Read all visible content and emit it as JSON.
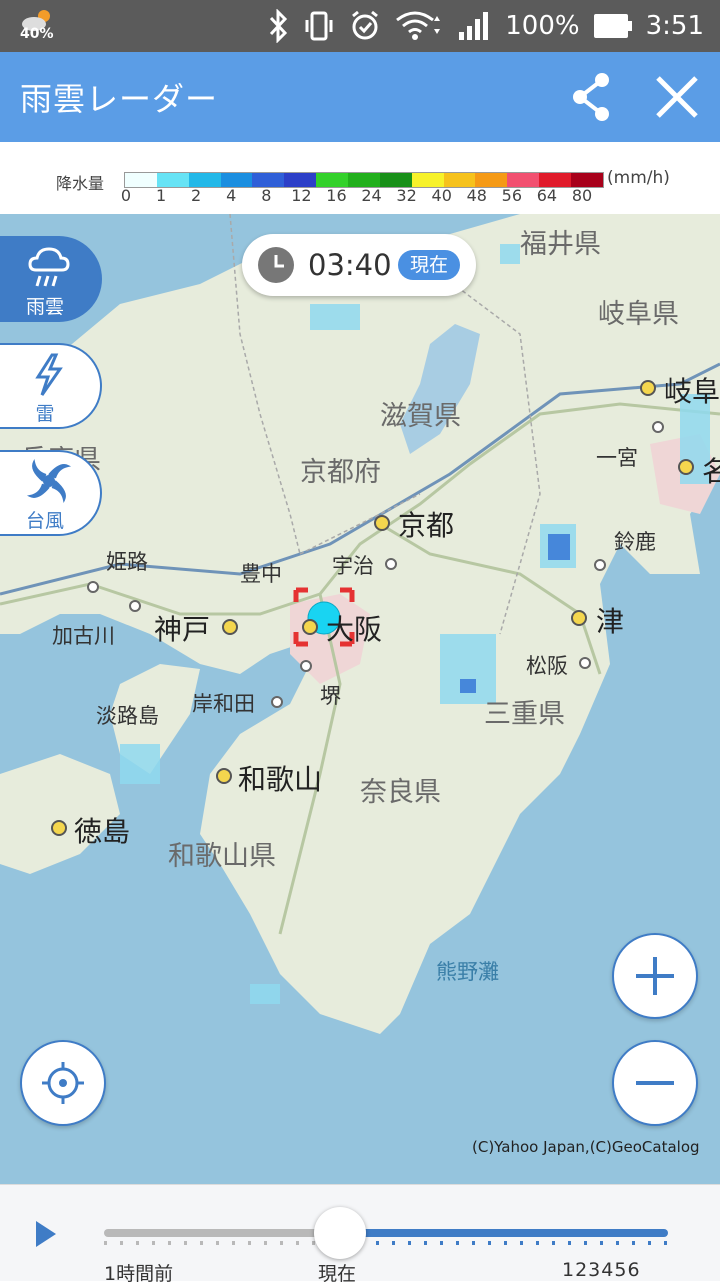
{
  "status_bar": {
    "weather_temp": "40%",
    "battery": "100%",
    "time": "3:51",
    "icons": [
      "bluetooth-icon",
      "vibrate-icon",
      "alarm-icon",
      "wifi-icon",
      "signal-icon",
      "battery-icon"
    ]
  },
  "app_bar": {
    "title": "雨雲レーダー",
    "share_icon": "share-icon",
    "close_icon": "close-icon"
  },
  "legend": {
    "label": "降水量",
    "unit": "(mm/h)",
    "ticks": [
      "0",
      "1",
      "2",
      "4",
      "8",
      "12",
      "16",
      "24",
      "32",
      "40",
      "48",
      "56",
      "64",
      "80"
    ],
    "colors": [
      "#f0ffff",
      "#66e3f5",
      "#22b8e8",
      "#1a8ee0",
      "#2f5fd8",
      "#2c3fc8",
      "#33d12a",
      "#22b01c",
      "#189018",
      "#f7f22a",
      "#f6c21c",
      "#f59a16",
      "#f25070",
      "#e01a2a",
      "#a8001a"
    ]
  },
  "time_display": {
    "time": "03:40",
    "badge": "現在"
  },
  "side_tabs": [
    {
      "label": "雨雲",
      "icon": "rain-cloud-icon",
      "active": true
    },
    {
      "label": "雷",
      "icon": "lightning-icon",
      "active": false
    },
    {
      "label": "台風",
      "icon": "typhoon-icon",
      "active": false
    }
  ],
  "map": {
    "prefectures": [
      "福井県",
      "岐阜県",
      "滋賀県",
      "京都府",
      "兵庫県",
      "三重県",
      "奈良県",
      "和歌山県"
    ],
    "major_cities": [
      "岐阜",
      "京都",
      "名",
      "神戸",
      "大阪",
      "津",
      "和歌山",
      "徳島"
    ],
    "minor_cities": [
      "一宮",
      "宇治",
      "鈴鹿",
      "姫路",
      "豊中",
      "加古川",
      "松阪",
      "岸和田",
      "堺",
      "淡路島"
    ],
    "sea": "熊野灘",
    "copyright": "(C)Yahoo Japan,(C)GeoCatalog"
  },
  "controls": {
    "zoom_in_icon": "plus-icon",
    "zoom_out_icon": "minus-icon",
    "locate_icon": "crosshair-icon"
  },
  "timeline": {
    "start_label": "1時間前",
    "now_label": "現在",
    "end_label": "123456",
    "position": 0.42
  }
}
